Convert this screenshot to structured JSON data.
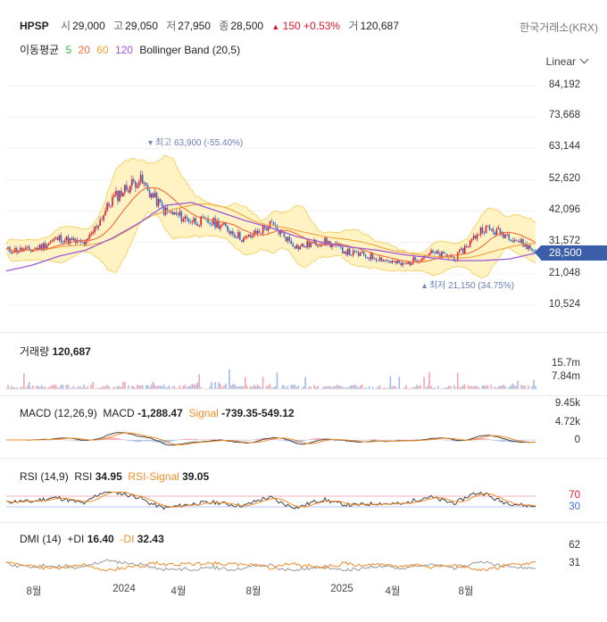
{
  "header": {
    "symbol": "HPSP",
    "open_label": "시",
    "open": "29,000",
    "high_label": "고",
    "high": "29,050",
    "low_label": "저",
    "low": "27,950",
    "close_label": "종",
    "close": "28,500",
    "change_arrow": "▲",
    "change": "150",
    "change_pct": "+0.53%",
    "volume_label": "거",
    "volume": "120,687",
    "exchange": "한국거래소(KRX)"
  },
  "indicators_bar": {
    "ma_label": "이동평균",
    "ma_periods": [
      "5",
      "20",
      "60",
      "120"
    ],
    "bollinger": "Bollinger Band (20,5)"
  },
  "scale_mode": "Linear",
  "colors": {
    "up": "#e0162b",
    "ma5": "#39b54a",
    "ma20": "#f26b38",
    "ma60": "#f2a33a",
    "ma120": "#9b59d6",
    "bollinger_fill": "#fff3c4",
    "bollinger_line": "#f5d36b",
    "price_tag": "#3a5fa8",
    "volume_up": "#f2a5ad",
    "volume_down": "#9fbbe8",
    "macd": "#444444",
    "signal": "#f08c2a",
    "rsi": "#444444",
    "rsi_signal": "#f08c2a",
    "plus_di": "#999999",
    "minus_di": "#f08c2a"
  },
  "price_axis": [
    "84,192",
    "73,668",
    "63,144",
    "52,620",
    "42,096",
    "31,572",
    "21,048",
    "10,524"
  ],
  "current_price_tag": "28,500",
  "annotations": {
    "high": "최고 63,900 (-55.40%)",
    "low": "최저 21,150 (34.75%)"
  },
  "volume_pane": {
    "label": "거래량",
    "value": "120,687",
    "axis": [
      "15.7m",
      "7.84m"
    ]
  },
  "macd_pane": {
    "label": "MACD (12,26,9)",
    "macd_label": "MACD",
    "macd_value": "-1,288.47",
    "signal_label": "Signal",
    "signal_value": "-739.35-549.12",
    "axis": [
      "9.45k",
      "4.72k",
      "0"
    ]
  },
  "rsi_pane": {
    "label": "RSI (14,9)",
    "rsi_label": "RSI",
    "rsi_value": "34.95",
    "signal_label": "RSI-Signal",
    "signal_value": "39.05",
    "axis": [
      "70",
      "30"
    ]
  },
  "dmi_pane": {
    "label": "DMI (14)",
    "plus_label": "+DI",
    "plus_value": "16.40",
    "minus_label": "-DI",
    "minus_value": "32.43",
    "axis": [
      "62",
      "31"
    ]
  },
  "x_axis": [
    "8월",
    "2024",
    "4월",
    "8월",
    "2025",
    "4월",
    "8월"
  ],
  "chart_data": {
    "type": "line",
    "title": "HPSP",
    "ylim": [
      10524,
      84192
    ],
    "x": [
      "8월",
      "2024",
      "4월",
      "8월",
      "2025",
      "4월",
      "8월"
    ],
    "series": [
      {
        "name": "close",
        "values": [
          29000,
          29000,
          33000,
          31000,
          46000,
          53000,
          42000,
          39000,
          38000,
          32500,
          37500,
          30000,
          32000,
          28000,
          26500,
          24000,
          28000,
          26500,
          36500,
          34000,
          28500
        ]
      },
      {
        "name": "ma120",
        "values": [
          22000,
          24000,
          27000,
          29000,
          33000,
          38000,
          44000,
          45000,
          42000,
          39000,
          36500,
          33500,
          31500,
          30000,
          29000,
          27500,
          26500,
          25500,
          25500,
          26000,
          28000
        ]
      }
    ]
  }
}
